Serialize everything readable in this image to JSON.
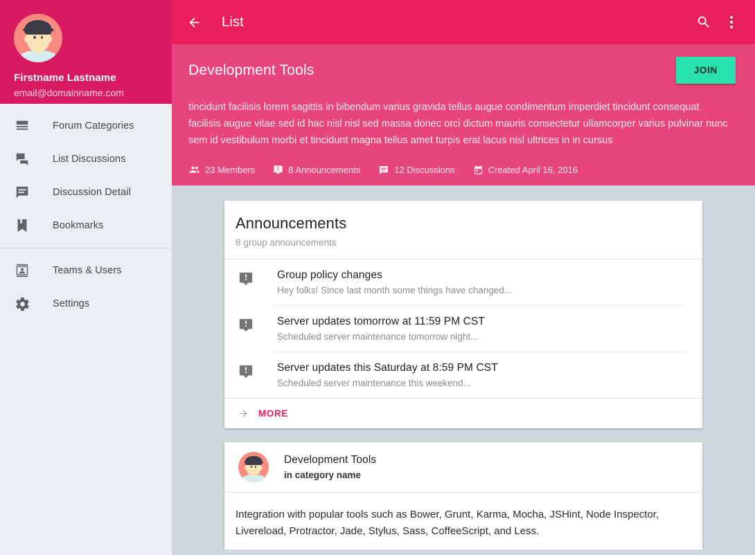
{
  "theme": {
    "appbar_pink": "#ea1e5f",
    "header_pink": "#e8457c",
    "sidebar_header_pink": "#d81b60",
    "sidebar_bg": "#eceff1",
    "content_bg": "#cfd8dc",
    "join_green": "#2ae2ae",
    "link_pink": "#e91e63"
  },
  "sidebar": {
    "user_name": "Firstname Lastname",
    "user_email": "email@domainname.com",
    "avatar_icon": "user-avatar",
    "groups": [
      {
        "items": [
          {
            "label": "Forum Categories",
            "icon": "view-agenda-icon",
            "key": "forum-categories"
          },
          {
            "label": "List Discussions",
            "icon": "forum-icon",
            "key": "list-discussions"
          },
          {
            "label": "Discussion Detail",
            "icon": "comment-icon",
            "key": "discussion-detail"
          },
          {
            "label": "Bookmarks",
            "icon": "bookmark-icon",
            "key": "bookmarks"
          }
        ]
      },
      {
        "items": [
          {
            "label": "Teams & Users",
            "icon": "contacts-icon",
            "key": "teams-users"
          },
          {
            "label": "Settings",
            "icon": "gear-icon",
            "key": "settings"
          }
        ]
      }
    ]
  },
  "appbar": {
    "back_icon": "arrow-back-icon",
    "title": "List",
    "search_icon": "search-icon",
    "overflow_icon": "more-vert-icon"
  },
  "group_header": {
    "title": "Development Tools",
    "join_label": "JOIN",
    "description": "tincidunt facilisis lorem sagittis in bibendum varius gravida tellus augue condimentum imperdiet tincidunt consequat facilisis augue vitae sed id hac nisl nisl sed massa donec orci dictum mauris consectetur ullamcorper varius pulvinar nunc sem id vestibulum morbi et tincidunt magna tellus amet turpis erat lacus nisl ultrices in in cursus",
    "meta": [
      {
        "icon": "people-outline-icon",
        "label": "23 Members"
      },
      {
        "icon": "announcement-icon",
        "label": "8 Announcements"
      },
      {
        "icon": "comment-icon",
        "label": "12 Discussions"
      },
      {
        "icon": "calendar-icon",
        "label": "Created April 16, 2016"
      }
    ]
  },
  "announcements_card": {
    "title": "Announcements",
    "subtitle": "8 group announcements",
    "items": [
      {
        "icon": "announcement-icon",
        "title": "Group policy changes",
        "subtitle": "Hey folks! Since last month some things have changed..."
      },
      {
        "icon": "announcement-icon",
        "title": "Server updates tomorrow at 11:59 PM CST",
        "subtitle": "Scheduled server maintenance tomorrow night..."
      },
      {
        "icon": "announcement-icon",
        "title": "Server updates this Saturday at 8:59 PM CST",
        "subtitle": "Scheduled server maintenance this weekend..."
      }
    ],
    "more_label": "MORE",
    "more_icon": "arrow-forward-icon"
  },
  "post_card": {
    "avatar_icon": "user-avatar",
    "title": "Development Tools",
    "subtitle": "in category name",
    "body": "Integration with popular tools such as Bower, Grunt, Karma, Mocha, JSHint, Node Inspector, Livereload, Protractor, Jade, Stylus, Sass, CoffeeScript, and Less."
  }
}
